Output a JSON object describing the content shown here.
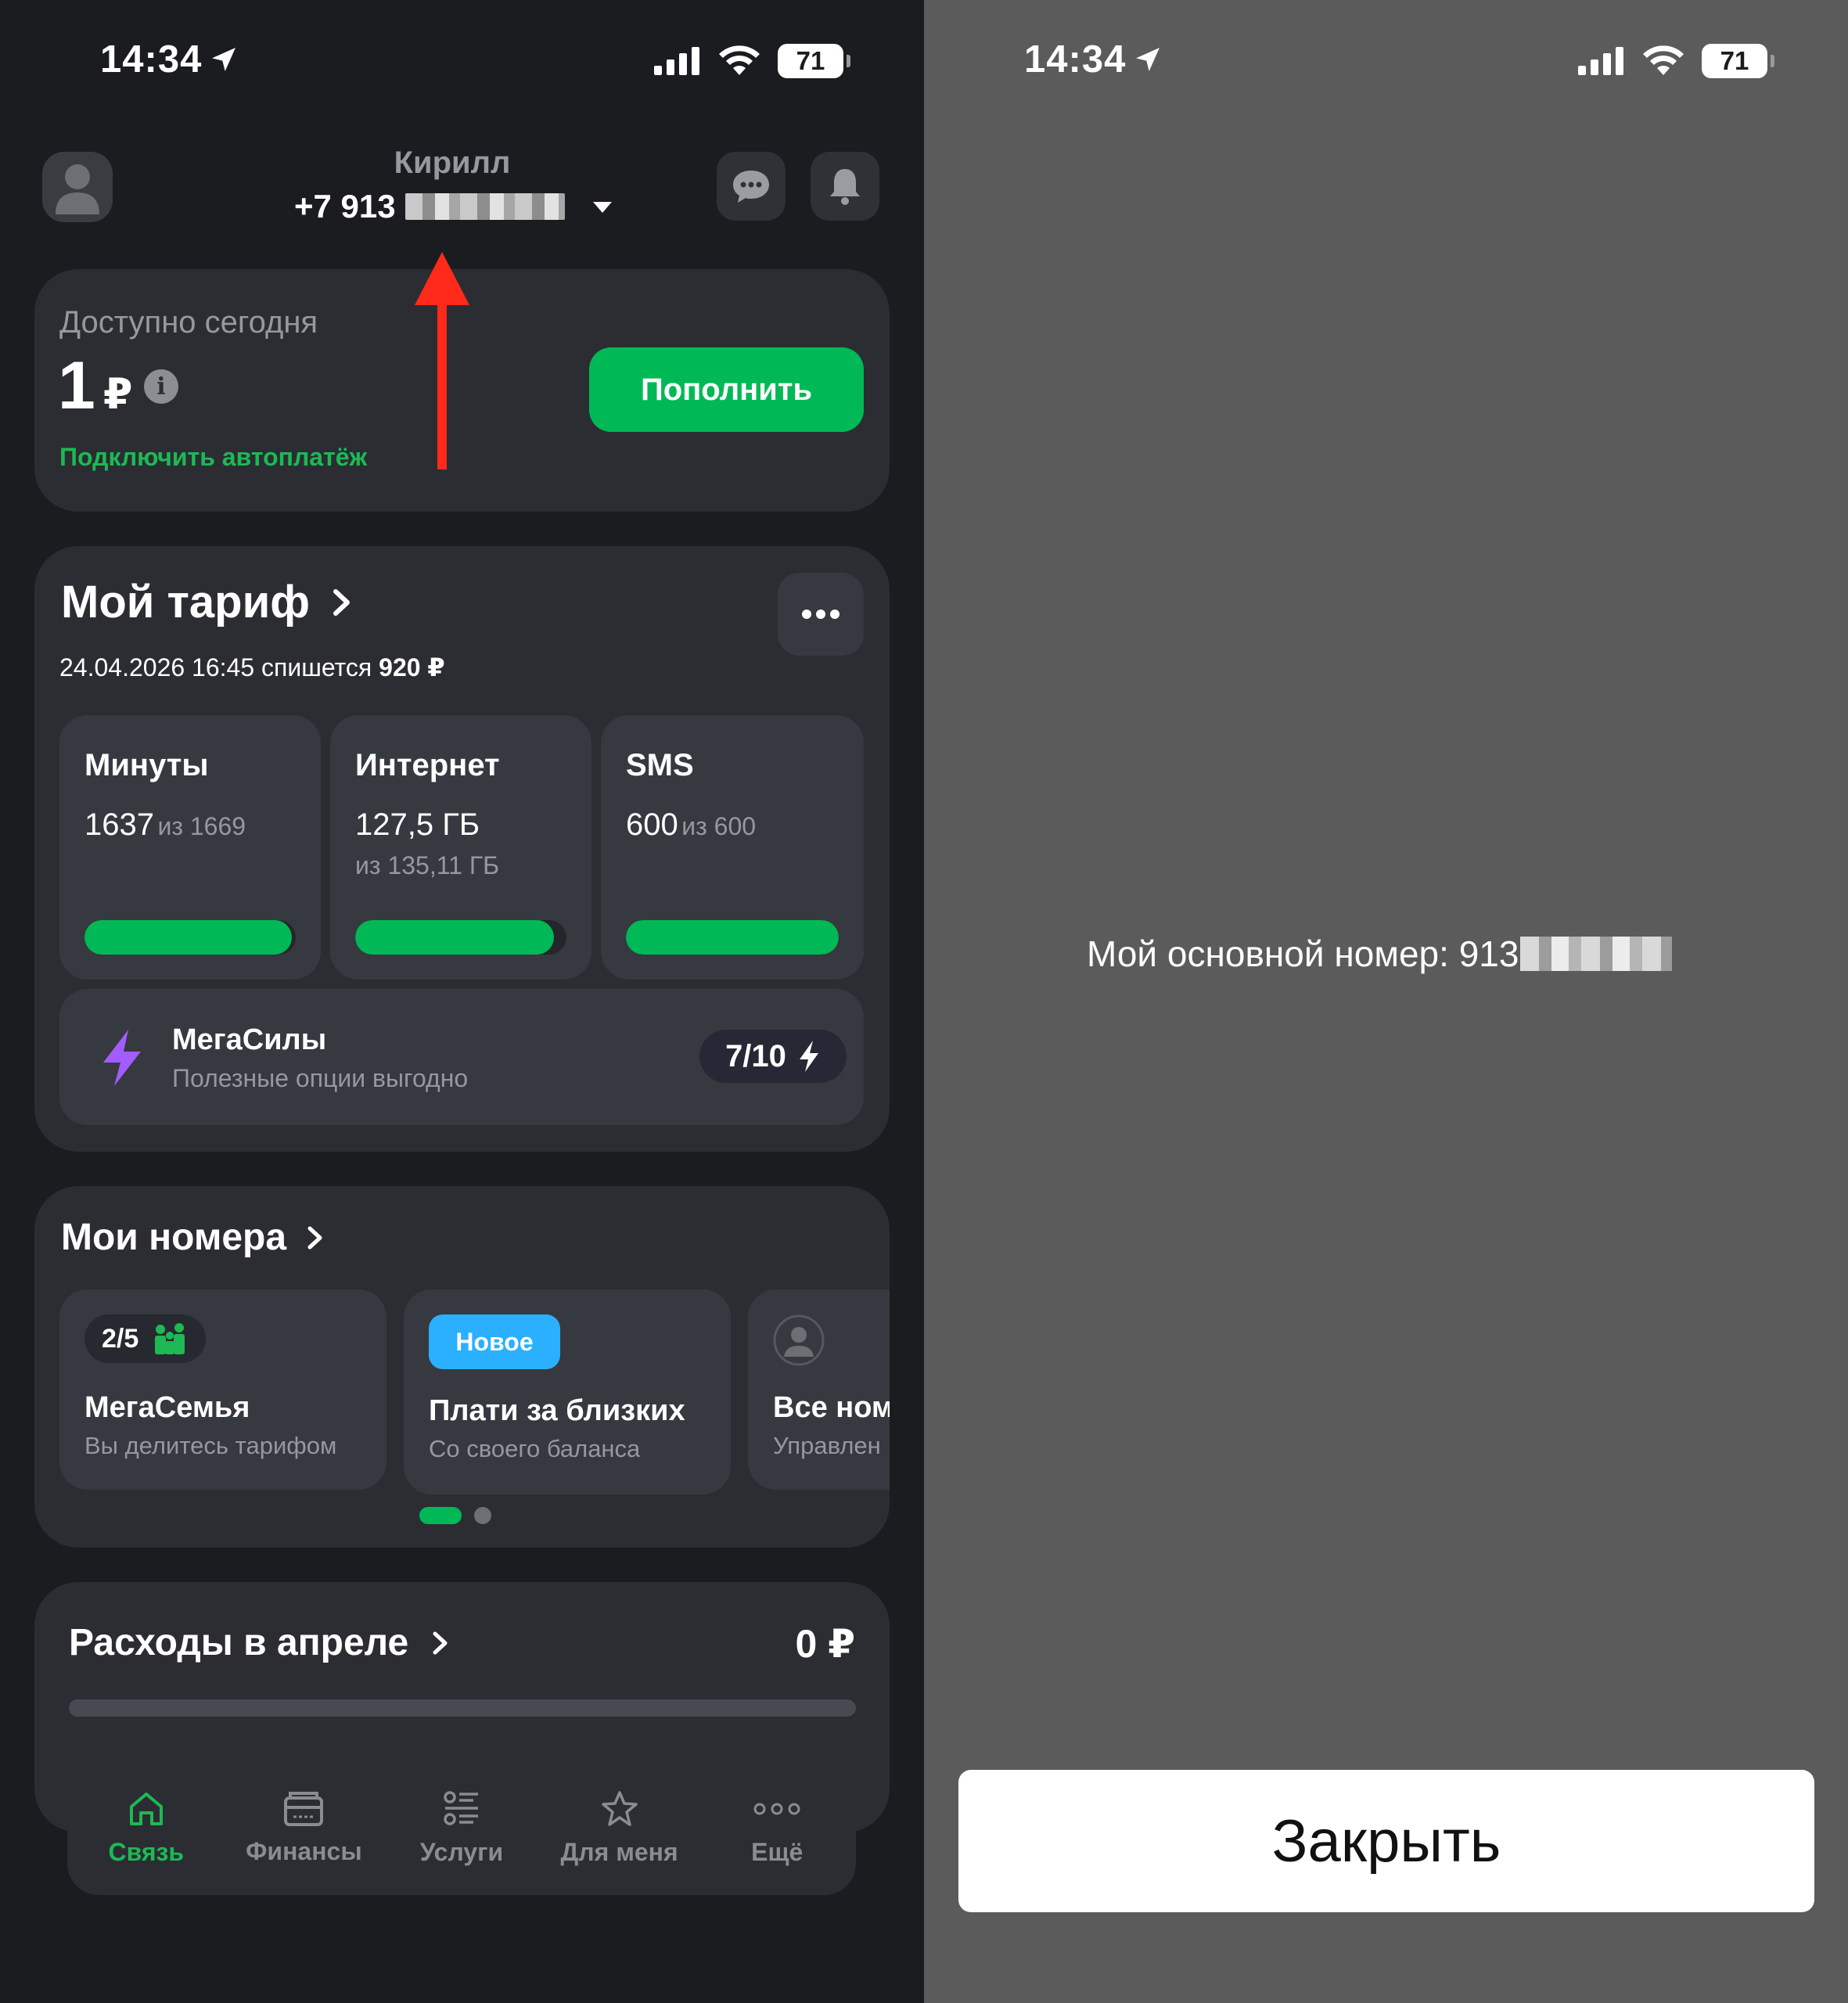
{
  "left": {
    "status": {
      "time": "14:34",
      "battery": "71"
    },
    "header": {
      "name": "Кирилл",
      "phone_prefix": "+7 913"
    },
    "balance": {
      "title": "Доступно сегодня",
      "amount": "1",
      "currency": "₽",
      "topup_label": "Пополнить",
      "autopay_label": "Подключить автоплатёж"
    },
    "tariff": {
      "title": "Мой тариф",
      "charge_text": "24.04.2026 16:45 спишется",
      "charge_amount": "920 ₽",
      "tiles": [
        {
          "title": "Минуты",
          "value": "1637",
          "of": "из 1669",
          "fraction": 0.98
        },
        {
          "title": "Интернет",
          "value": "127,5 ГБ",
          "of": "из 135,11 ГБ",
          "fraction": 0.94
        },
        {
          "title": "SMS",
          "value": "600",
          "of": "из 600",
          "fraction": 1.0
        }
      ],
      "megasily": {
        "title": "МегаСилы",
        "subtitle": "Полезные опции выгодно",
        "score": "7/10"
      }
    },
    "numbers": {
      "title": "Мои номера",
      "cards": [
        {
          "badge": "2/5",
          "title": "МегаСемья",
          "subtitle": "Вы делитесь тарифом"
        },
        {
          "badge": "Новое",
          "title": "Плати за близких",
          "subtitle": "Со своего баланса"
        },
        {
          "title": "Все ном",
          "subtitle": "Управлен"
        }
      ]
    },
    "expenses": {
      "title": "Расходы в апреле",
      "amount": "0 ₽"
    },
    "nav": [
      {
        "label": "Связь",
        "icon": "home-icon",
        "active": true
      },
      {
        "label": "Финансы",
        "icon": "wallet-icon",
        "active": false
      },
      {
        "label": "Услуги",
        "icon": "services-list-icon",
        "active": false
      },
      {
        "label": "Для меня",
        "icon": "star-icon",
        "active": false
      },
      {
        "label": "Ещё",
        "icon": "more-dots-icon",
        "active": false
      }
    ],
    "colors": {
      "accent": "#00b956",
      "arrow": "#ff2a1a",
      "megasily": "#a35cff",
      "badge_new": "#2bb0ff"
    }
  },
  "right": {
    "status": {
      "time": "14:34",
      "battery": "71"
    },
    "message": "Мой основной номер: 913",
    "close_label": "Закрыть"
  }
}
